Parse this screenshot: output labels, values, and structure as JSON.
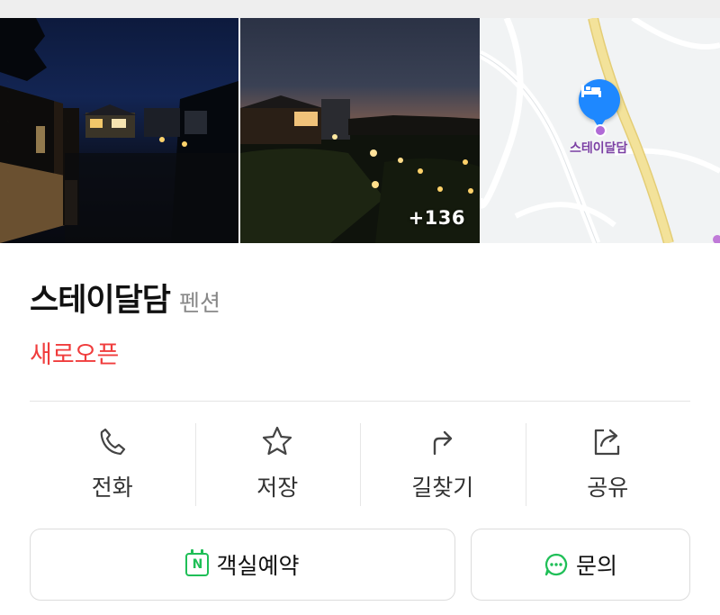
{
  "photos": {
    "count_badge": "+136",
    "map_label": "스테이달담"
  },
  "place": {
    "name": "스테이달담",
    "category": "펜션",
    "status": "새로오픈"
  },
  "actions": [
    {
      "label": "전화",
      "icon": "phone-icon"
    },
    {
      "label": "저장",
      "icon": "star-icon"
    },
    {
      "label": "길찾기",
      "icon": "directions-icon"
    },
    {
      "label": "공유",
      "icon": "share-icon"
    }
  ],
  "buttons": {
    "reserve_label": "객실예약",
    "inquiry_label": "문의"
  },
  "colors": {
    "status": "#f03c3c",
    "map_pin": "#1e88ff",
    "naver_green": "#1fbf57",
    "map_road": "#f3e29a"
  }
}
